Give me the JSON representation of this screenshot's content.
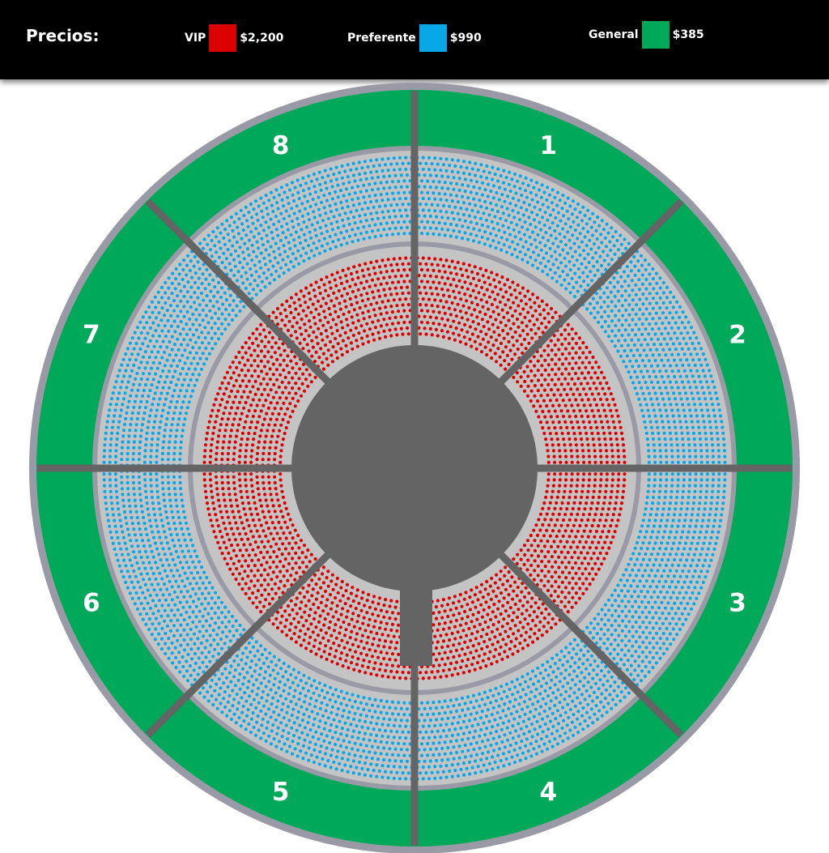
{
  "header": {
    "title": "Precios:",
    "legend": [
      {
        "label": "VIP",
        "price": "$2,200",
        "color": "#dd0000"
      },
      {
        "label": "Preferente",
        "price": "$990",
        "color": "#08a8e8"
      },
      {
        "label": "General",
        "price": "$385",
        "color": "#00a859"
      }
    ]
  },
  "sections": [
    {
      "label": "1"
    },
    {
      "label": "2"
    },
    {
      "label": "3"
    },
    {
      "label": "4"
    },
    {
      "label": "5"
    },
    {
      "label": "6"
    },
    {
      "label": "7"
    },
    {
      "label": "8"
    }
  ],
  "colors": {
    "general": "#00a859",
    "preferente": "#08a8e8",
    "vip": "#dd0000",
    "stage": "#646464",
    "ring": "#9a9aa6",
    "floor": "#c4c4c4"
  }
}
